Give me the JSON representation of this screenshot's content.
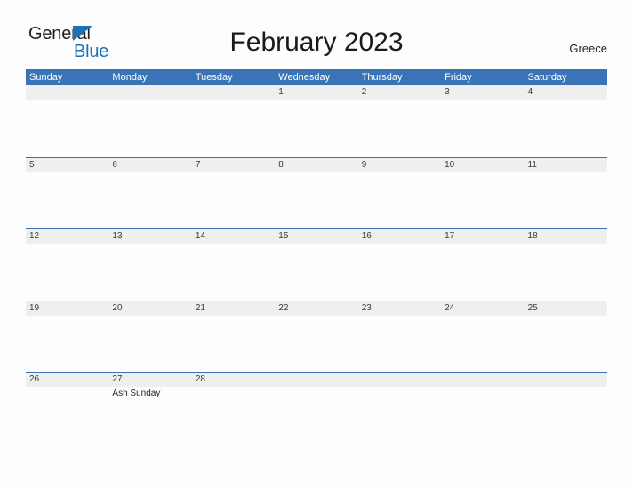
{
  "brand": {
    "name_part1": "General",
    "name_part2": "Blue",
    "triangle_icon": "triangle-right-icon",
    "accent_color": "#1b72b8"
  },
  "header": {
    "title": "February 2023",
    "region": "Greece"
  },
  "calendar": {
    "header_bg_color": "#3b74b6",
    "date_band_color": "#efefef",
    "weekdays": [
      "Sunday",
      "Monday",
      "Tuesday",
      "Wednesday",
      "Thursday",
      "Friday",
      "Saturday"
    ],
    "weeks": [
      {
        "days": [
          {
            "date": "",
            "event": ""
          },
          {
            "date": "",
            "event": ""
          },
          {
            "date": "",
            "event": ""
          },
          {
            "date": "1",
            "event": ""
          },
          {
            "date": "2",
            "event": ""
          },
          {
            "date": "3",
            "event": ""
          },
          {
            "date": "4",
            "event": ""
          }
        ]
      },
      {
        "days": [
          {
            "date": "5",
            "event": ""
          },
          {
            "date": "6",
            "event": ""
          },
          {
            "date": "7",
            "event": ""
          },
          {
            "date": "8",
            "event": ""
          },
          {
            "date": "9",
            "event": ""
          },
          {
            "date": "10",
            "event": ""
          },
          {
            "date": "11",
            "event": ""
          }
        ]
      },
      {
        "days": [
          {
            "date": "12",
            "event": ""
          },
          {
            "date": "13",
            "event": ""
          },
          {
            "date": "14",
            "event": ""
          },
          {
            "date": "15",
            "event": ""
          },
          {
            "date": "16",
            "event": ""
          },
          {
            "date": "17",
            "event": ""
          },
          {
            "date": "18",
            "event": ""
          }
        ]
      },
      {
        "days": [
          {
            "date": "19",
            "event": ""
          },
          {
            "date": "20",
            "event": ""
          },
          {
            "date": "21",
            "event": ""
          },
          {
            "date": "22",
            "event": ""
          },
          {
            "date": "23",
            "event": ""
          },
          {
            "date": "24",
            "event": ""
          },
          {
            "date": "25",
            "event": ""
          }
        ]
      },
      {
        "days": [
          {
            "date": "26",
            "event": ""
          },
          {
            "date": "27",
            "event": "Ash Sunday"
          },
          {
            "date": "28",
            "event": ""
          },
          {
            "date": "",
            "event": ""
          },
          {
            "date": "",
            "event": ""
          },
          {
            "date": "",
            "event": ""
          },
          {
            "date": "",
            "event": ""
          }
        ]
      }
    ]
  }
}
